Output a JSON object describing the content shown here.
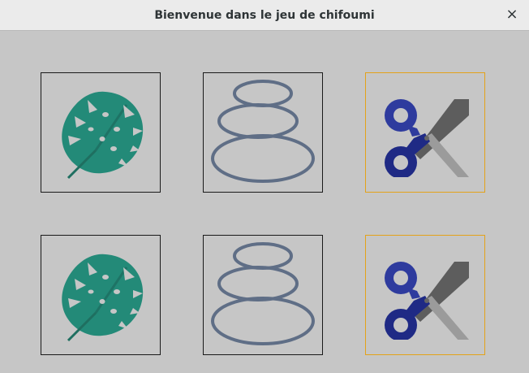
{
  "window": {
    "title": "Bienvenue dans le jeu de chifoumi",
    "close_icon": "close-icon",
    "close_glyph": "×"
  },
  "grid": {
    "rows": [
      {
        "cards": [
          {
            "choice": "feuille",
            "icon": "leaf-icon",
            "selected": false
          },
          {
            "choice": "pierre",
            "icon": "stones-icon",
            "selected": false
          },
          {
            "choice": "ciseaux",
            "icon": "scissors-icon",
            "selected": true
          }
        ]
      },
      {
        "cards": [
          {
            "choice": "feuille",
            "icon": "leaf-icon",
            "selected": false
          },
          {
            "choice": "pierre",
            "icon": "stones-icon",
            "selected": false
          },
          {
            "choice": "ciseaux",
            "icon": "scissors-icon",
            "selected": true
          }
        ]
      }
    ]
  },
  "colors": {
    "background": "#c6c6c6",
    "card_border": "#1a1a1a",
    "selected_border": "#e3a21a",
    "leaf": "#238a78",
    "stones": "#5f6e86",
    "scissors_handle": "#2e3b9e",
    "scissors_blade_dark": "#5d5d5d",
    "scissors_blade_light": "#9b9b9b"
  }
}
